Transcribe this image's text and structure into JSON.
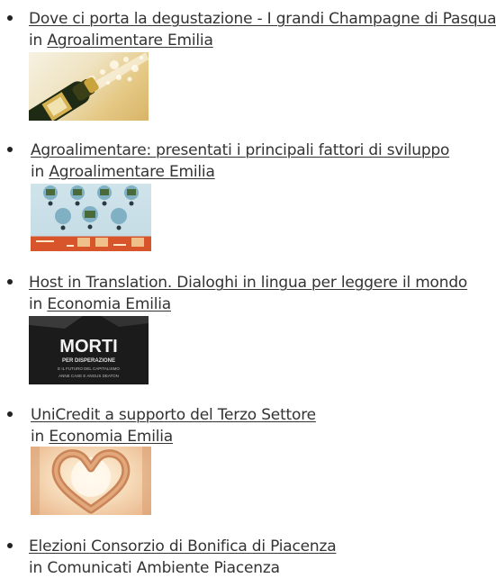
{
  "articles": [
    {
      "title": "Dove ci porta la degustazione - I grandi Champagne di Pasqua",
      "in_label": "in",
      "category": "Agroalimentare Emilia",
      "thumb_icon": "champagne-bottle-image"
    },
    {
      "title": "Agroalimentare: presentati i principali fattori di sviluppo",
      "in_label": "in",
      "category": "Agroalimentare Emilia",
      "thumb_icon": "agrifood-infographic-image"
    },
    {
      "title": "Host in Translation. Dialoghi in lingua per leggere il mondo",
      "in_label": "in",
      "category": "Economia Emilia",
      "thumb_icon": "book-cover-image",
      "thumb_text": {
        "big": "MORTI",
        "sub": "PER DISPERAZIONE",
        "line1": "E IL FUTURO DEL CAPITALISMO",
        "line2": "ANNE CASE E ANGUS DEATON"
      }
    },
    {
      "title": "UniCredit a supporto del Terzo Settore",
      "in_label": "in",
      "category": "Economia Emilia",
      "thumb_icon": "hands-heart-image"
    },
    {
      "title": "Elezioni Consorzio di Bonifica di Piacenza",
      "in_label": "in",
      "category": "Comunicati Ambiente Piacenza"
    }
  ],
  "colors": {
    "text": "#333333",
    "bullet": "#222222"
  }
}
